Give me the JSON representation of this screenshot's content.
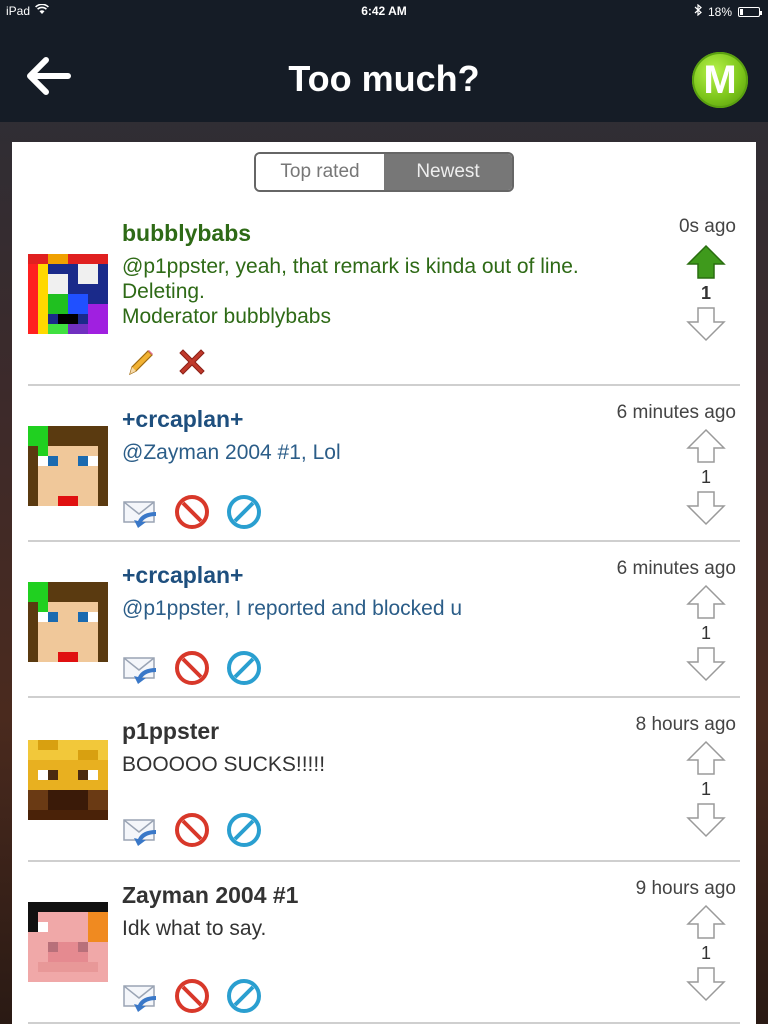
{
  "status": {
    "device": "iPad",
    "time": "6:42 AM",
    "battery": "18%",
    "battery_level": 0.18
  },
  "nav": {
    "title": "Too much?",
    "logo_letter": "M"
  },
  "tabs": [
    {
      "label": "Top rated",
      "active": false
    },
    {
      "label": "Newest",
      "active": true
    }
  ],
  "comments": [
    {
      "author": "bubblybabs",
      "text": "@p1ppster, yeah, that remark is kinda out of line.\nDeleting.\nModerator bubblybabs",
      "time": "0s ago",
      "votes": "1",
      "upvoted": true
    },
    {
      "author": "+crcaplan+",
      "text": "@Zayman 2004 #1, Lol",
      "time": "6 minutes ago",
      "votes": "1",
      "upvoted": false
    },
    {
      "author": "+crcaplan+",
      "text": "@p1ppster, I reported and blocked u",
      "time": "6 minutes ago",
      "votes": "1",
      "upvoted": false
    },
    {
      "author": "p1ppster",
      "text": "BOOOOO SUCKS!!!!!",
      "time": "8 hours ago",
      "votes": "1",
      "upvoted": false
    },
    {
      "author": "Zayman 2004 #1",
      "text": "Idk what to say.",
      "time": "9 hours ago",
      "votes": "1",
      "upvoted": false
    }
  ],
  "colors": {
    "upvote_active": "#3f9a1c",
    "moderator_text": "#2e6a16",
    "crcaplan_text": "#1e4f7e"
  },
  "icons": {
    "edit": "pencil-icon",
    "delete": "red-x-icon",
    "reply": "reply-mail-icon",
    "report": "block-icon",
    "block": "ban-icon"
  }
}
